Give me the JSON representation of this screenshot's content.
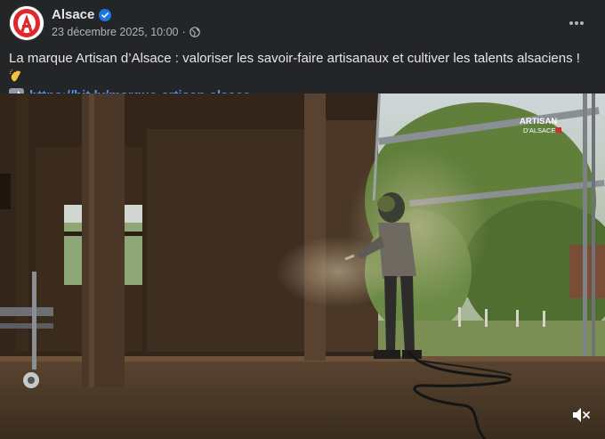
{
  "post": {
    "page_name": "Alsace",
    "date": "23 décembre 2025, 10:00",
    "separator": "·",
    "text": "La marque Artisan d’Alsace : valoriser les savoir-faire artisanaux et cultiver les talents alsaciens !",
    "link": "https://bit.ly/marque-artisan-alsace",
    "watermark": {
      "line1": "ARTISAN",
      "line2": "D'ALSACE"
    },
    "icons": {
      "verified": "verified-badge-icon",
      "audience": "globe-icon",
      "more": "more-options-icon",
      "emoji": "clapping-hands-emoji",
      "arrow": "right-arrow-emoji",
      "mute": "speaker-muted-icon"
    },
    "colors": {
      "background": "#242526",
      "link": "#4599ff",
      "verified": "#1b74e4",
      "brand_red": "#e1262c"
    }
  }
}
